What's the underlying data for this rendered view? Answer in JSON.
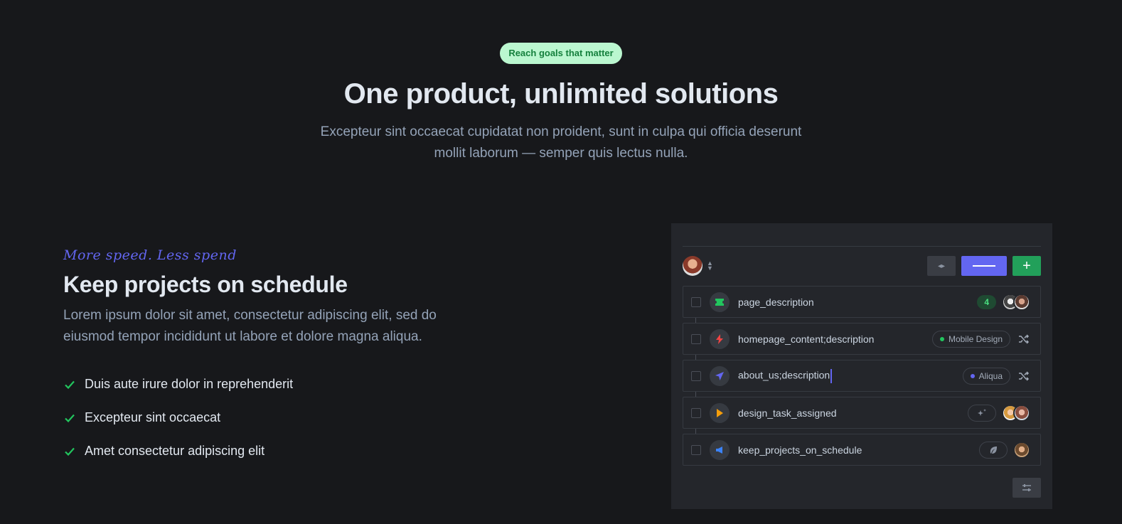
{
  "hero": {
    "badge": "Reach goals that matter",
    "title": "One product, unlimited solutions",
    "subtitle": "Excepteur sint occaecat cupidatat non proident, sunt in culpa qui officia deserunt mollit laborum — semper quis lectus nulla."
  },
  "feature": {
    "kicker": "More speed. Less spend",
    "title": "Keep projects on schedule",
    "lead": "Lorem ipsum dolor sit amet, consectetur adipiscing elit, sed do eiusmod tempor incididunt ut labore et dolore magna aliqua.",
    "bullets": [
      "Duis aute irure dolor in reprehenderit",
      "Excepteur sint occaecat",
      "Amet consectetur adipiscing elit"
    ]
  },
  "panel": {
    "rows": [
      {
        "label": "page_description",
        "icon": "ticket-icon",
        "icon_color": "#22c55e",
        "count": "4"
      },
      {
        "label": "homepage_content;description",
        "icon": "bolt-icon",
        "icon_color": "#ef4444",
        "tag": "Mobile Design",
        "tag_color": "#22c55e"
      },
      {
        "label": "about_us;description",
        "icon": "navigation-icon",
        "icon_color": "#6366f1",
        "tag": "Aliqua",
        "tag_color": "#6366f1"
      },
      {
        "label": "design_task_assigned",
        "icon": "play-icon",
        "icon_color": "#f59e0b"
      },
      {
        "label": "keep_projects_on_schedule",
        "icon": "megaphone-icon",
        "icon_color": "#3b82f6"
      }
    ]
  },
  "colors": {
    "background": "#17181b",
    "panel": "#24262b",
    "accent_indigo": "#6366f1",
    "accent_green": "#22a05a",
    "badge_bg": "#bbf7d0"
  }
}
